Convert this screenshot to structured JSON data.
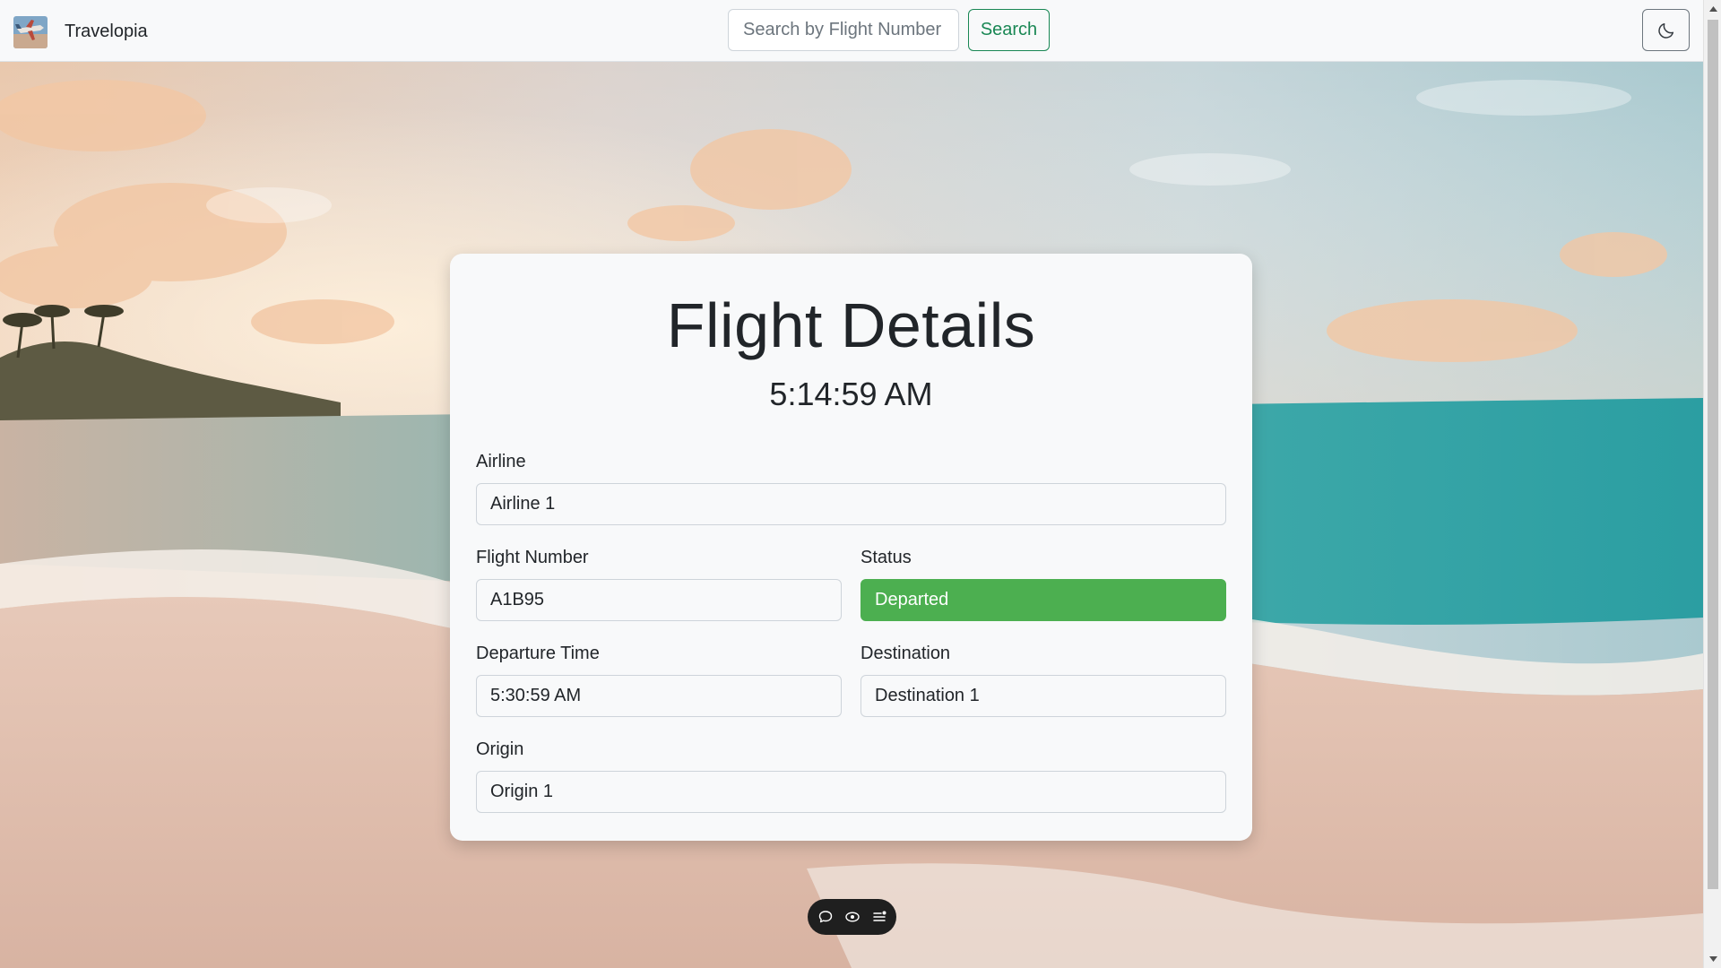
{
  "navbar": {
    "brand_name": "Travelopia",
    "logo_icon": "airplane-logo-icon",
    "search_placeholder": "Search by Flight Number",
    "search_button_label": "Search",
    "theme_toggle_icon": "moon-icon"
  },
  "card": {
    "title": "Flight Details",
    "clock": "5:14:59 AM",
    "fields": {
      "airline": {
        "label": "Airline",
        "value": "Airline 1"
      },
      "flight_number": {
        "label": "Flight Number",
        "value": "A1B95"
      },
      "status": {
        "label": "Status",
        "value": "Departed",
        "color": "#4caf50"
      },
      "departure_time": {
        "label": "Departure Time",
        "value": "5:30:59 AM"
      },
      "destination": {
        "label": "Destination",
        "value": "Destination 1"
      },
      "origin": {
        "label": "Origin",
        "value": "Origin 1"
      }
    }
  },
  "floating_toolbar": {
    "icons": [
      "chat-bubble-icon",
      "eye-icon",
      "list-icon"
    ]
  },
  "colors": {
    "accent_green": "#198754",
    "status_green": "#4caf50",
    "card_background": "#f8f9fa",
    "toolbar_background": "#1f1f1f"
  }
}
